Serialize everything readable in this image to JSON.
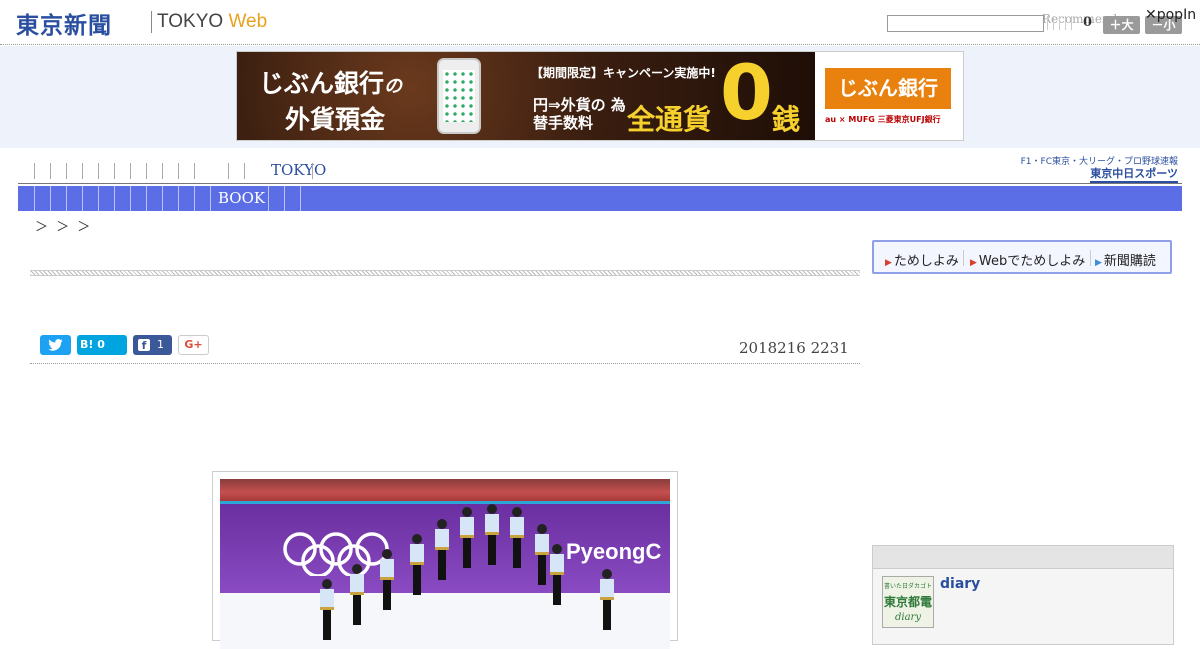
{
  "header": {
    "logo_jp": "東京新聞",
    "logo_en": "TOKYO",
    "logo_web": "Web",
    "search_placeholder": "",
    "recommend_label": "Recommend",
    "recommend_count": "0",
    "font_large": "＋大",
    "font_small": "－小",
    "popin": "✕popIn"
  },
  "ad": {
    "line1": "じぶん銀行",
    "line1_particle": "の",
    "line2": "外貨預金",
    "promo": "【期間限定】キャンペーン実施中!",
    "rate_label": "円⇒外貨の 為替手数料",
    "all_currency": "全通貨",
    "zero": "0",
    "sen": "銭",
    "brand": "じぶん銀行",
    "partners": "au × MUFG 三菱東京UFJ銀行"
  },
  "nav": {
    "tokyo": "TOKYO",
    "sports_line1": "F1・FC東京・大リーグ・プロ野球速報",
    "sports_line2": "東京中日スポーツ",
    "book": "BOOK"
  },
  "breadcrumb": "＞ ＞ ＞",
  "article": {
    "share": {
      "hatena_label": "B!",
      "hatena_count": "0",
      "facebook_count": "1",
      "google_label": "G+"
    },
    "date": "2018216 2231",
    "photo": {
      "wordmark": "PyeongC"
    }
  },
  "sidebar": {
    "menu": [
      "ためしよみ",
      "Webでためしよみ",
      "新聞購読"
    ],
    "diary_thumb_lines": [
      "書いた日ダカゴト",
      "東京都電",
      "diary"
    ],
    "diary_link": "diary"
  },
  "colors": {
    "brand_blue": "#2b4fa0",
    "subnav_blue": "#5b6ee6",
    "accent_orange": "#e8a21e",
    "twitter": "#1da1f2",
    "hatena": "#00a4de",
    "facebook": "#3b5998"
  }
}
